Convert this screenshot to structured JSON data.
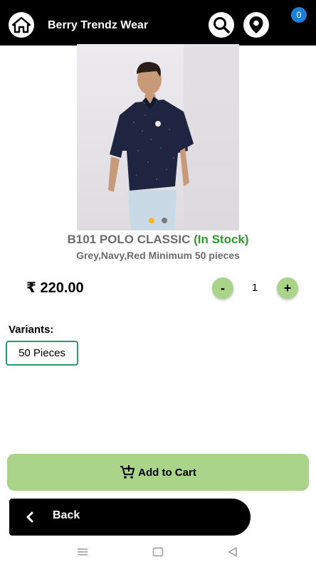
{
  "header": {
    "title": "Berry Trendz Wear",
    "cart_count": "0",
    "icons": [
      "home-icon",
      "search-icon",
      "location-pin-icon"
    ]
  },
  "product": {
    "name": "B101 POLO CLASSIC",
    "stock_status": "(In Stock)",
    "description": "Grey,Navy,Red  Minimum 50 pieces",
    "price": "₹ 220.00",
    "quantity": "1",
    "minus_label": "-",
    "plus_label": "+",
    "image_count": 2,
    "active_image_index": 0
  },
  "variants": {
    "label": "Variants:",
    "options": [
      "50 Pieces"
    ]
  },
  "actions": {
    "add_to_cart_label": "Add to Cart",
    "back_label": "Back"
  },
  "colors": {
    "accent_green": "#a9d48a",
    "stock_green": "#2e9a2e",
    "badge_blue": "#1e7fd6",
    "variant_border": "#2a9a6a"
  }
}
